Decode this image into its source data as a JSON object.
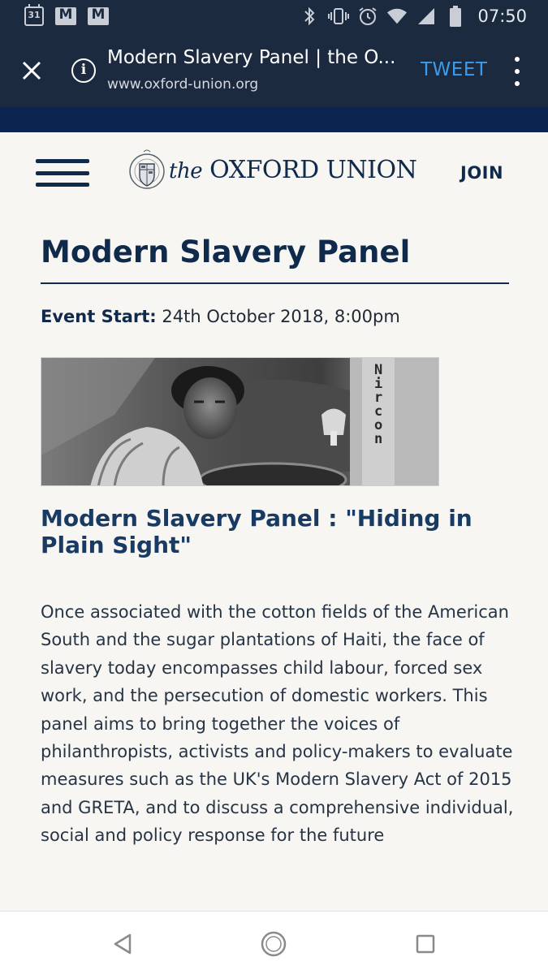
{
  "status_bar": {
    "calendar_day": "31",
    "time": "07:50",
    "icons": [
      "calendar-icon",
      "gmail-icon",
      "gmail-icon",
      "bluetooth-icon",
      "vibrate-icon",
      "alarm-icon",
      "wifi-icon",
      "signal-icon",
      "battery-icon"
    ]
  },
  "browser": {
    "page_title": "Modern Slavery Panel | the O...",
    "url": "www.oxford-union.org",
    "action_label": "TWEET"
  },
  "site_header": {
    "logo_the": "the",
    "logo_name": "OXFORD UNION",
    "join_label": "JOIN"
  },
  "event": {
    "title": "Modern Slavery Panel",
    "start_label": "Event Start:",
    "start_value": "24th October 2018, 8:00pm",
    "photo_sign_text": "Nircon",
    "subtitle": "Modern Slavery Panel  :  \"Hiding in Plain Sight\"",
    "description": "Once associated with the cotton fields of the American South and the sugar plantations of Haiti, the face of slavery today encompasses child labour, forced sex work, and the persecution of domestic workers.  This panel aims to bring together the voices of philanthropists, activists and policy-makers to evaluate measures such as the UK's Modern Slavery Act of 2015 and GRETA, and to discuss a comprehensive individual, social and policy response for the future"
  },
  "colors": {
    "status_bar_bg": "#1b2a3f",
    "nav_stripe": "#0c2450",
    "brand_navy": "#102a4c",
    "tweet_blue": "#3d9be9",
    "page_bg": "#f7f6f3"
  }
}
